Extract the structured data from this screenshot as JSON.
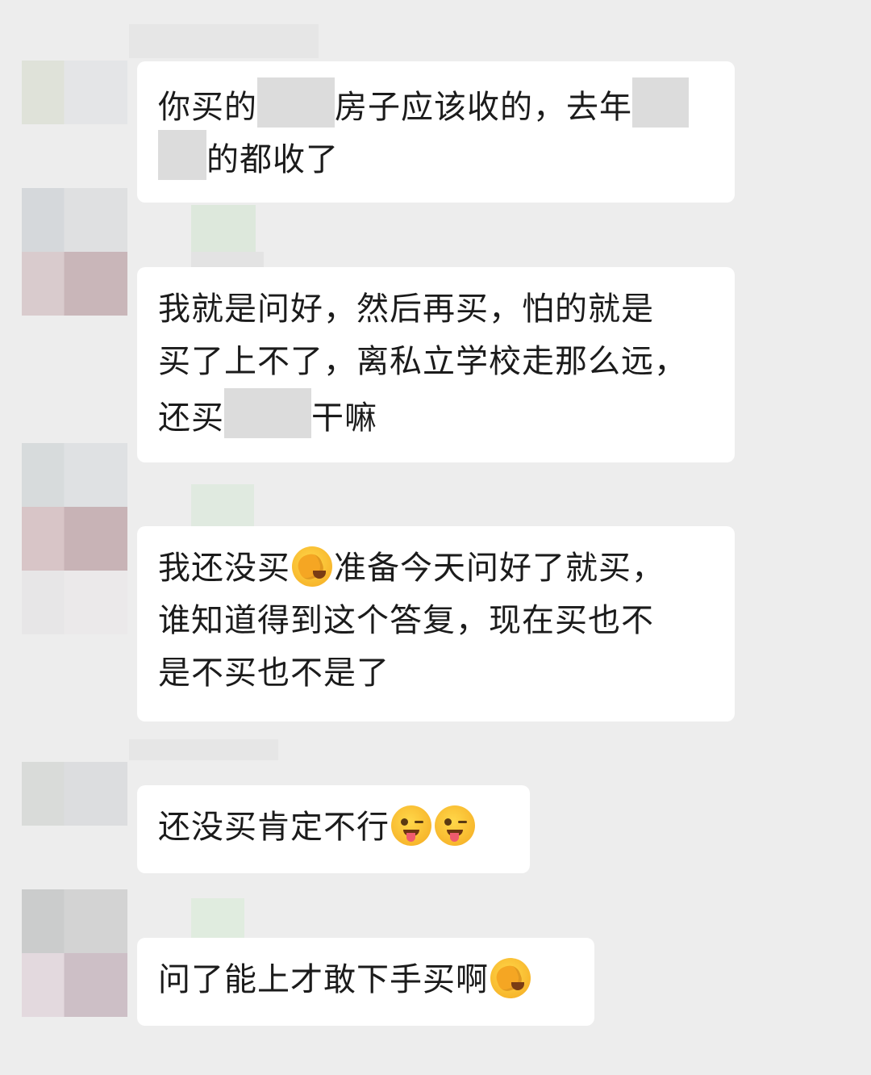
{
  "messages": [
    {
      "lines": [
        [
          {
            "t": "你买的"
          },
          {
            "redact": true
          },
          {
            "t": "房子应该收的，去年"
          },
          {
            "redact": true
          }
        ],
        [
          {
            "redact": true
          },
          {
            "t": "的都收了"
          }
        ]
      ]
    },
    {
      "lines": [
        [
          {
            "t": "我就是问好，然后再买，怕的就是"
          }
        ],
        [
          {
            "t": "买了上不了，离私立学校走那么远，"
          }
        ],
        [
          {
            "t": "还买"
          },
          {
            "redact": true
          },
          {
            "t": "干嘛"
          }
        ]
      ]
    },
    {
      "lines": [
        [
          {
            "t": "我还没买"
          },
          {
            "emoji": "facepalm-emoji"
          },
          {
            "t": "准备今天问好了就买，"
          }
        ],
        [
          {
            "t": "谁知道得到这个答复，现在买也不"
          }
        ],
        [
          {
            "t": "是不买也不是了"
          }
        ]
      ]
    },
    {
      "lines": [
        [
          {
            "t": "还没买肯定不行"
          },
          {
            "emoji": "wink-tongue-emoji"
          },
          {
            "emoji": "wink-tongue-emoji"
          }
        ]
      ]
    },
    {
      "lines": [
        [
          {
            "t": "问了能上才敢下手买啊"
          },
          {
            "emoji": "facepalm-emoji"
          }
        ]
      ]
    }
  ],
  "colors": {
    "background": "#ededed",
    "bubble": "#ffffff",
    "text": "#1b1b1b",
    "redaction": "#dcdcdc"
  }
}
